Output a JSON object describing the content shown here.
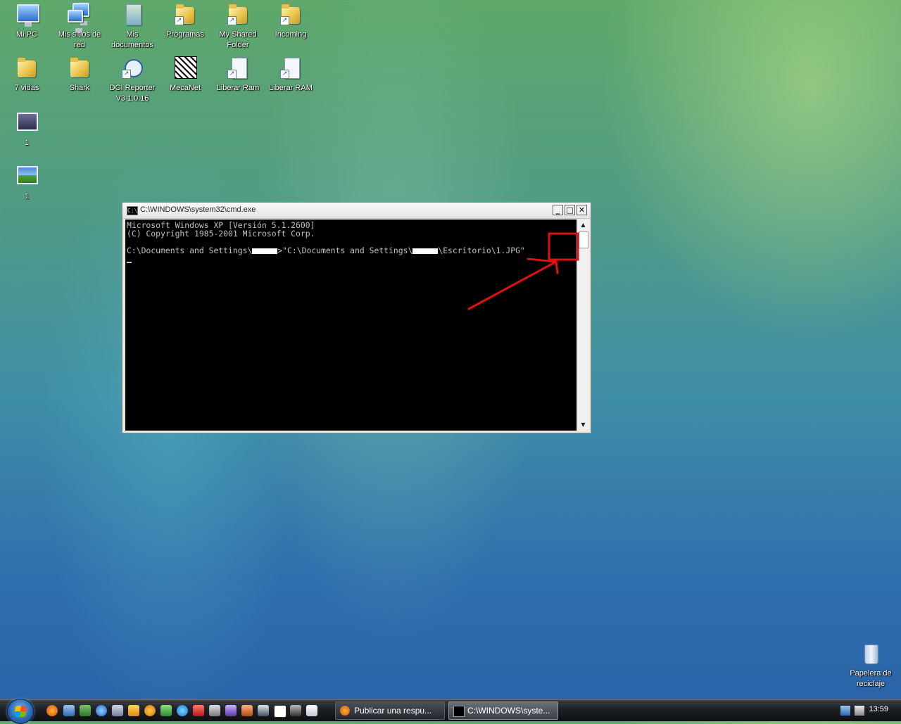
{
  "desktop": {
    "icons": [
      {
        "label": "Mi PC"
      },
      {
        "label": "Mis sitios de red"
      },
      {
        "label": "Mis documentos"
      },
      {
        "label": "Programas"
      },
      {
        "label": "My Shared Folder"
      },
      {
        "label": "Incoming"
      },
      {
        "label": "7 vidas"
      },
      {
        "label": "Shark"
      },
      {
        "label": "DCI Reporter V3 1.0.16"
      },
      {
        "label": "MecaNet"
      },
      {
        "label": "Liberar Ram"
      },
      {
        "label": "Liberar RAM"
      },
      {
        "label": "1"
      },
      {
        "label": "1"
      },
      {
        "label": "Papelera de reciclaje"
      }
    ]
  },
  "cmd_window": {
    "title": "C:\\WINDOWS\\system32\\cmd.exe",
    "icon_text": "C:\\",
    "minimize": "_",
    "maximize": "□",
    "close": "✕",
    "lines": {
      "l1": "Microsoft Windows XP [Versión 5.1.2600]",
      "l2": "(C) Copyright 1985-2001 Microsoft Corp.",
      "prompt_a": "C:\\Documents and Settings\\",
      "prompt_b": ">\"C:\\Documents and Settings\\",
      "prompt_c": "\\Escritorio\\1.JPG\""
    },
    "scroll_up": "▲",
    "scroll_down": "▼"
  },
  "taskbar": {
    "buttons": [
      {
        "label": "Publicar una respu..."
      },
      {
        "label": "C:\\WINDOWS\\syste..."
      }
    ],
    "clock": "13:59"
  },
  "colors": {
    "annotation": "#e01010"
  }
}
